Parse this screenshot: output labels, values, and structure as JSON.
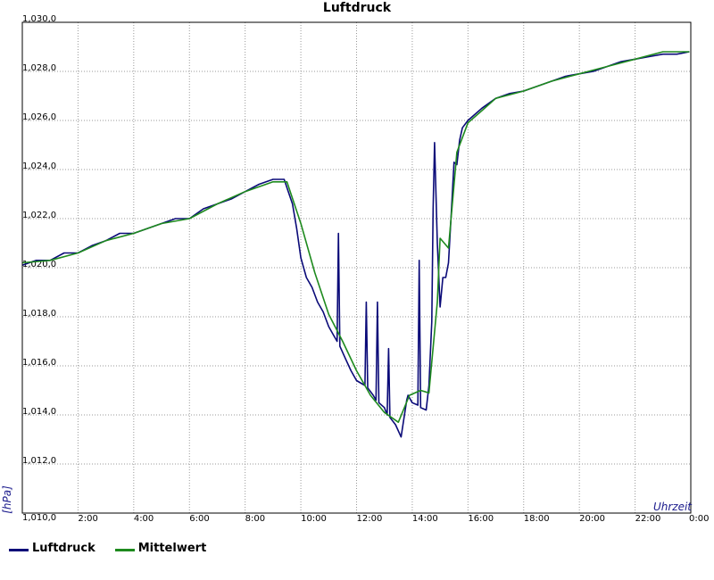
{
  "chart_data": {
    "type": "line",
    "title": "Luftdruck",
    "xlabel": "Uhrzeit",
    "ylabel": "[hPa]",
    "xlim": [
      0,
      24
    ],
    "ylim": [
      1010.0,
      1030.0
    ],
    "x_ticks": [
      "2:00",
      "4:00",
      "6:00",
      "8:00",
      "10:00",
      "12:00",
      "14:00",
      "16:00",
      "18:00",
      "20:00",
      "22:00",
      "0:00"
    ],
    "y_ticks": [
      "1,010,0",
      "1,012,0",
      "1,014,0",
      "1,016,0",
      "1,018,0",
      "1,020,0",
      "1,022,0",
      "1,024,0",
      "1,026,0",
      "1,028,0",
      "1,030,0"
    ],
    "grid": true,
    "legend_position": "bottom-left",
    "series": [
      {
        "name": "Luftdruck",
        "color": "#0a0a78",
        "x": [
          0.0,
          0.5,
          1.0,
          1.5,
          2.0,
          2.5,
          3.0,
          3.5,
          4.0,
          4.5,
          5.0,
          5.5,
          6.0,
          6.5,
          7.0,
          7.5,
          8.0,
          8.5,
          9.0,
          9.4,
          9.55,
          9.7,
          9.85,
          10.0,
          10.2,
          10.4,
          10.6,
          10.8,
          11.0,
          11.2,
          11.3,
          11.35,
          11.4,
          11.6,
          11.8,
          12.0,
          12.3,
          12.35,
          12.4,
          12.6,
          12.7,
          12.75,
          12.8,
          13.0,
          13.1,
          13.15,
          13.2,
          13.4,
          13.6,
          13.8,
          13.85,
          14.0,
          14.2,
          14.25,
          14.3,
          14.5,
          14.6,
          14.7,
          14.75,
          14.8,
          14.9,
          15.0,
          15.1,
          15.2,
          15.3,
          15.4,
          15.5,
          15.6,
          15.7,
          15.8,
          16.0,
          16.2,
          16.5,
          17.0,
          17.5,
          18.0,
          18.5,
          19.0,
          19.5,
          20.0,
          20.5,
          21.0,
          21.5,
          22.0,
          22.5,
          23.0,
          23.5,
          23.95
        ],
        "values": [
          1020.1,
          1020.3,
          1020.3,
          1020.6,
          1020.6,
          1020.9,
          1021.1,
          1021.4,
          1021.4,
          1021.6,
          1021.8,
          1022.0,
          1022.0,
          1022.4,
          1022.6,
          1022.8,
          1023.1,
          1023.4,
          1023.6,
          1023.6,
          1023.1,
          1022.6,
          1021.6,
          1020.4,
          1019.6,
          1019.2,
          1018.6,
          1018.2,
          1017.6,
          1017.2,
          1017.0,
          1021.4,
          1016.8,
          1016.3,
          1015.8,
          1015.4,
          1015.2,
          1018.6,
          1015.1,
          1014.8,
          1014.6,
          1018.6,
          1014.5,
          1014.3,
          1014.0,
          1016.7,
          1013.9,
          1013.6,
          1013.1,
          1014.6,
          1014.8,
          1014.5,
          1014.4,
          1020.3,
          1014.3,
          1014.2,
          1015.2,
          1017.8,
          1022.4,
          1025.1,
          1021.0,
          1018.4,
          1019.6,
          1019.6,
          1020.2,
          1022.2,
          1024.3,
          1024.2,
          1025.2,
          1025.7,
          1026.0,
          1026.2,
          1026.5,
          1026.9,
          1027.1,
          1027.2,
          1027.4,
          1027.6,
          1027.8,
          1027.9,
          1028.0,
          1028.2,
          1028.4,
          1028.5,
          1028.6,
          1028.7,
          1028.7,
          1028.8
        ]
      },
      {
        "name": "Mittelwert",
        "color": "#1e8a1e",
        "x": [
          0.0,
          1.0,
          2.0,
          3.0,
          4.0,
          5.0,
          6.0,
          7.0,
          8.0,
          9.0,
          9.5,
          10.0,
          10.5,
          11.0,
          11.5,
          12.0,
          12.5,
          13.0,
          13.5,
          13.9,
          14.3,
          14.6,
          14.9,
          15.0,
          15.3,
          15.6,
          16.0,
          16.5,
          17.0,
          18.0,
          19.0,
          20.0,
          21.0,
          22.0,
          23.0,
          23.95
        ],
        "values": [
          1020.2,
          1020.3,
          1020.6,
          1021.1,
          1021.4,
          1021.8,
          1022.0,
          1022.6,
          1023.1,
          1023.5,
          1023.5,
          1021.8,
          1019.8,
          1018.1,
          1017.0,
          1015.8,
          1014.8,
          1014.1,
          1013.7,
          1014.8,
          1015.0,
          1014.9,
          1018.6,
          1021.2,
          1020.8,
          1024.7,
          1025.9,
          1026.4,
          1026.9,
          1027.2,
          1027.6,
          1027.9,
          1028.2,
          1028.5,
          1028.8,
          1028.8
        ]
      }
    ]
  }
}
